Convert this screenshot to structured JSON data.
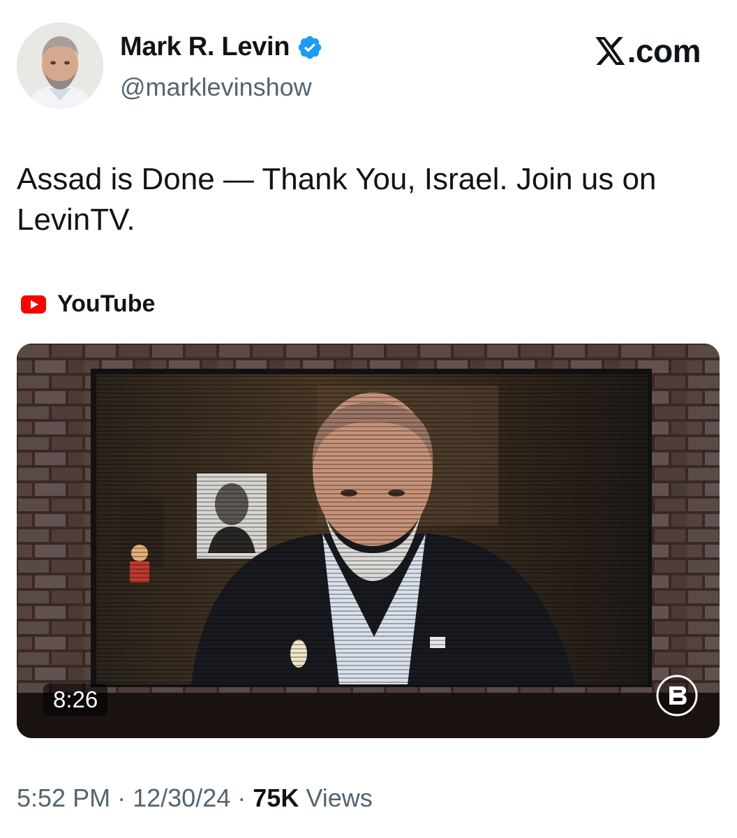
{
  "author": {
    "display_name": "Mark R. Levin",
    "handle": "@marklevinshow",
    "verified": true,
    "verified_color": "#1d9bf0"
  },
  "brand": {
    "label": ".com",
    "icon": "x-logo-icon"
  },
  "tweet": {
    "text": "Assad is Done — Thank You, Israel. Join us on LevinTV."
  },
  "link_card": {
    "source": "YouTube",
    "source_icon": "youtube-icon",
    "source_color": "#ff0000",
    "video": {
      "duration": "8:26",
      "badge_icon": "rumble-b-icon"
    }
  },
  "meta": {
    "time": "5:52 PM",
    "separator": "·",
    "date": "12/30/24",
    "views_count": "75K",
    "views_label": "Views"
  }
}
